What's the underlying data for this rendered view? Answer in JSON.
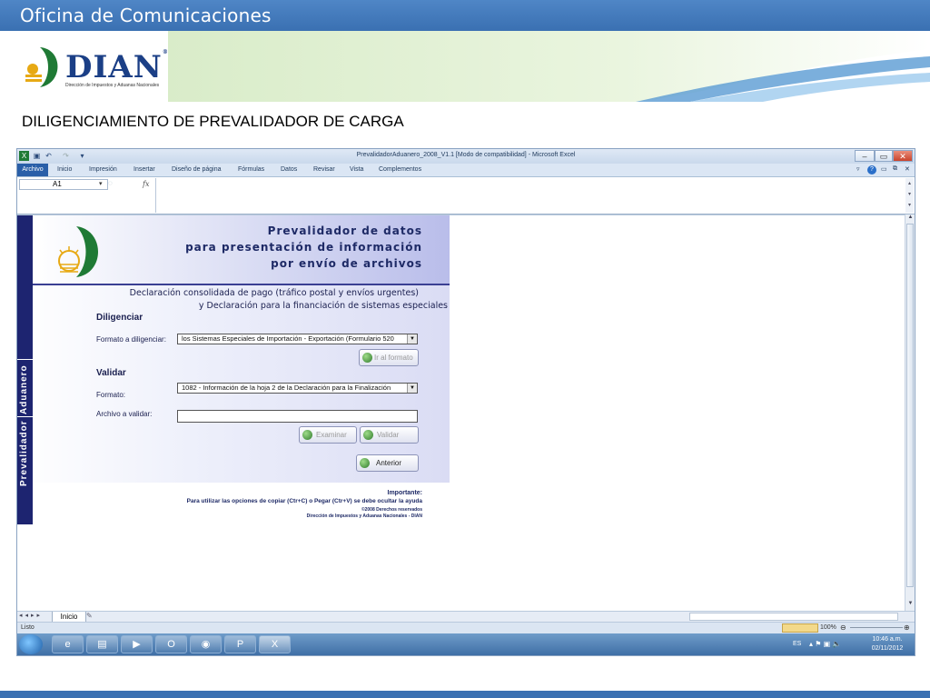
{
  "slide": {
    "top_title": "Oficina de Comunicaciones",
    "logo_name": "DIAN",
    "logo_reg": "®",
    "logo_subtitle": "Dirección de Impuestos y Aduanas Nacionales",
    "heading": "DILIGENCIAMIENTO DE PREVALIDADOR DE CARGA"
  },
  "excel": {
    "window_title": "PrevalidadorAduanero_2008_V1.1  [Modo de compatibilidad] - Microsoft Excel",
    "menu": [
      "Archivo",
      "Inicio",
      "Impresión",
      "Insertar",
      "Diseño de página",
      "Fórmulas",
      "Datos",
      "Revisar",
      "Vista",
      "Complementos"
    ],
    "name_box": "A1",
    "fx": "fx",
    "sheet_tab": "Inicio",
    "status_ready": "Listo",
    "zoom": "100%"
  },
  "form": {
    "header_lines": [
      "Prevalidador de datos",
      "para presentación de información",
      "por envío de archivos"
    ],
    "sidebar_aduanero": "Aduanero",
    "sidebar_prevalidador": "Prevalidador",
    "subtitle_lines": [
      "Declaración consolidada de pago (tráfico postal y envíos urgentes)",
      "y Declaración para la financiación de sistemas especiales"
    ],
    "diligenciar_title": "Diligenciar",
    "formato_diligenciar_label": "Formato a diligenciar:",
    "formato_diligenciar_value": "los Sistemas Especiales de Importación - Exportación (Formulario 520",
    "ir_formato_button": "Ir al formato",
    "validar_title": "Validar",
    "formato_label": "Formato:",
    "formato_value": "1082 - Información de la hoja 2 de la Declaración para la Finalización",
    "archivo_label": "Archivo a validar:",
    "archivo_value": "",
    "examinar_button": "Examinar",
    "validar_button": "Validar",
    "anterior_button": "Anterior",
    "footer_important": "Importante:",
    "footer_note": "Para utilizar las opciones de copiar (Ctr+C) o Pegar (Ctr+V) se debe ocultar la ayuda",
    "footer_copy": "©2008 Derechos reservados",
    "footer_org": "Dirección de Impuestos y Aduanas Nacionales - DIAN"
  },
  "taskbar": {
    "language": "ES",
    "time": "10:46 a.m.",
    "date": "02/11/2012"
  },
  "colors": {
    "slide_blue": "#3a70b2",
    "form_navy": "#1d2470",
    "excel_accent": "#2a5fa8"
  }
}
